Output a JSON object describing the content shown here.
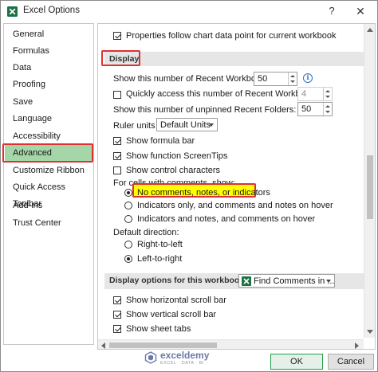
{
  "window": {
    "title": "Excel Options",
    "help_label": "?",
    "close_label": "✕"
  },
  "sidebar": {
    "items": [
      {
        "label": "General"
      },
      {
        "label": "Formulas"
      },
      {
        "label": "Data"
      },
      {
        "label": "Proofing"
      },
      {
        "label": "Save"
      },
      {
        "label": "Language"
      },
      {
        "label": "Accessibility"
      },
      {
        "label": "Advanced",
        "selected": true
      },
      {
        "label": "Customize Ribbon"
      },
      {
        "label": "Quick Access Toolbar"
      },
      {
        "label": "Add-ins"
      },
      {
        "label": "Trust Center"
      }
    ]
  },
  "content": {
    "top_option": {
      "label": "Properties follow chart data point for current workbook",
      "checked": true
    },
    "display": {
      "heading": "Display",
      "recent_workbooks": {
        "label": "Show this number of Recent Workbooks:",
        "value": "50"
      },
      "quick_access": {
        "label": "Quickly access this number of Recent Workbooks:",
        "value": "4",
        "checked": false
      },
      "recent_folders": {
        "label": "Show this number of unpinned Recent Folders:",
        "value": "50"
      },
      "ruler_units": {
        "label": "Ruler units",
        "value": "Default Units"
      },
      "show_formula_bar": {
        "label": "Show formula bar",
        "checked": true
      },
      "show_function_screentips": {
        "label": "Show function ScreenTips",
        "checked": true
      },
      "show_control_characters": {
        "label": "Show control characters",
        "checked": false
      },
      "comments": {
        "label": "For cells with comments, show:",
        "options": [
          {
            "label": "No comments, notes, or indicators",
            "selected": true
          },
          {
            "label": "Indicators only, and comments and notes on hover",
            "selected": false
          },
          {
            "label": "Indicators and notes, and comments on hover",
            "selected": false
          }
        ]
      },
      "default_direction": {
        "label": "Default direction:",
        "options": [
          {
            "label": "Right-to-left",
            "selected": false
          },
          {
            "label": "Left-to-right",
            "selected": true
          }
        ]
      }
    },
    "workbook_display": {
      "heading": "Display options for this workbook:",
      "workbook": "Find Comments in ...",
      "show_horizontal_scroll_bar": {
        "label": "Show horizontal scroll bar",
        "checked": true
      },
      "show_vertical_scroll_bar": {
        "label": "Show vertical scroll bar",
        "checked": true
      },
      "show_sheet_tabs": {
        "label": "Show sheet tabs",
        "checked": true
      }
    }
  },
  "footer": {
    "ok_label": "OK",
    "cancel_label": "Cancel"
  },
  "watermark": {
    "name": "exceldemy",
    "tagline": "EXCEL · DATA · BI"
  },
  "colors": {
    "selected_item": "#a5d6a7",
    "highlight_border": "#e03030",
    "highlight_fill": "#ffff00",
    "ok_border": "#1f9e45",
    "excel_green": "#1e7145"
  },
  "icons": {
    "app": "excel-icon",
    "info": "info-icon",
    "workbook": "excel-workbook-icon"
  }
}
